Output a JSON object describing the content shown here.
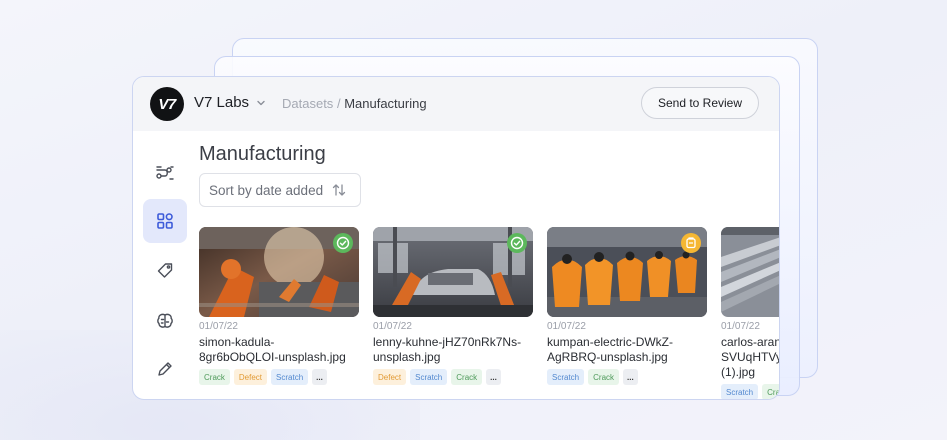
{
  "header": {
    "logo_text": "V7",
    "org_name": "V7 Labs",
    "breadcrumb_parent": "Datasets",
    "breadcrumb_separator": "/",
    "breadcrumb_current": "Manufacturing",
    "review_button_label": "Send to Review"
  },
  "sidebar": {
    "items": [
      {
        "icon": "workflow-icon",
        "active": false
      },
      {
        "icon": "datasets-grid-icon",
        "active": true
      },
      {
        "icon": "tag-icon",
        "active": false
      },
      {
        "icon": "brain-icon",
        "active": false
      },
      {
        "icon": "pencil-icon",
        "active": false
      }
    ]
  },
  "main": {
    "title": "Manufacturing",
    "sort_label": "Sort by date added"
  },
  "cards": [
    {
      "date": "01/07/22",
      "name_line1": "simon-kadula-",
      "name_line2": "8gr6bObQLOI-unsplash.jpg",
      "name_line3": "",
      "status": "complete",
      "tags": [
        "Crack",
        "Defect",
        "Scratch"
      ],
      "more": "..."
    },
    {
      "date": "01/07/22",
      "name_line1": "lenny-kuhne-jHZ70nRk7Ns-",
      "name_line2": "unsplash.jpg",
      "name_line3": "",
      "status": "complete",
      "tags": [
        "Defect",
        "Scratch",
        "Crack"
      ],
      "more": "..."
    },
    {
      "date": "01/07/22",
      "name_line1": "kumpan-electric-DWkZ-",
      "name_line2": "AgRBRQ-unsplash.jpg",
      "name_line3": "",
      "status": "pending",
      "tags": [
        "Scratch",
        "Crack"
      ],
      "more": "..."
    },
    {
      "date": "01/07/22",
      "name_line1": "carlos-aranda-",
      "name_line2": "SVUqHTVy",
      "name_line3": "(1).jpg",
      "status": "none",
      "tags": [
        "Scratch",
        "Crack"
      ],
      "more": ""
    }
  ],
  "colors": {
    "accent": "#e3e8fb",
    "status_complete": "#5cb85c",
    "status_pending": "#f5b733",
    "tag_crack": "#4e9a5a",
    "tag_defect": "#e29a34",
    "tag_scratch": "#5288cf"
  }
}
